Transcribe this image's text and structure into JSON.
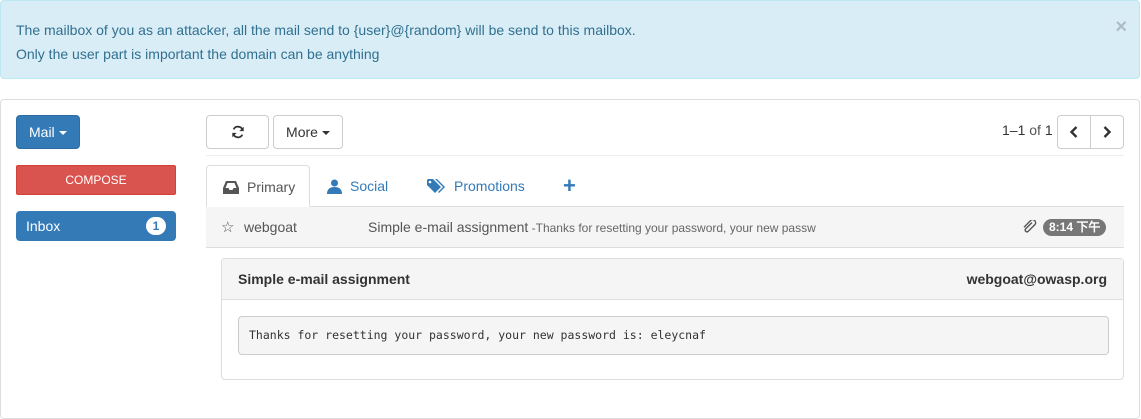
{
  "alert": {
    "line1": "The mailbox of you as an attacker, all the mail send to {user}@{random} will be send to this mailbox.",
    "line2": "Only the user part is important the domain can be anything",
    "close": "×"
  },
  "sidebar": {
    "mail_button": "Mail",
    "compose_button": "COMPOSE",
    "inbox_label": "Inbox",
    "inbox_count": "1"
  },
  "toolbar": {
    "more_label": "More",
    "pager_range": "1–1",
    "pager_of": "of",
    "pager_total": "1"
  },
  "tabs": [
    {
      "label": "Primary",
      "icon": "inbox-icon",
      "active": true
    },
    {
      "label": "Social",
      "icon": "user-icon",
      "active": false
    },
    {
      "label": "Promotions",
      "icon": "tags-icon",
      "active": false
    },
    {
      "label": "+",
      "icon": "plus-icon",
      "active": false
    }
  ],
  "mail_list": [
    {
      "star": "☆",
      "sender": "webgoat",
      "subject": "Simple e-mail assignment",
      "snippet": " -Thanks for resetting your password, your new passw",
      "time": "8:14 下午"
    }
  ],
  "open_email": {
    "subject": "Simple e-mail assignment",
    "from": "webgoat@owasp.org",
    "body": "Thanks for resetting your password, your new password is: eleycnaf"
  },
  "colors": {
    "primary": "#337ab7",
    "danger": "#d9534f",
    "info_bg": "#d9edf7",
    "info_text": "#31708f"
  }
}
